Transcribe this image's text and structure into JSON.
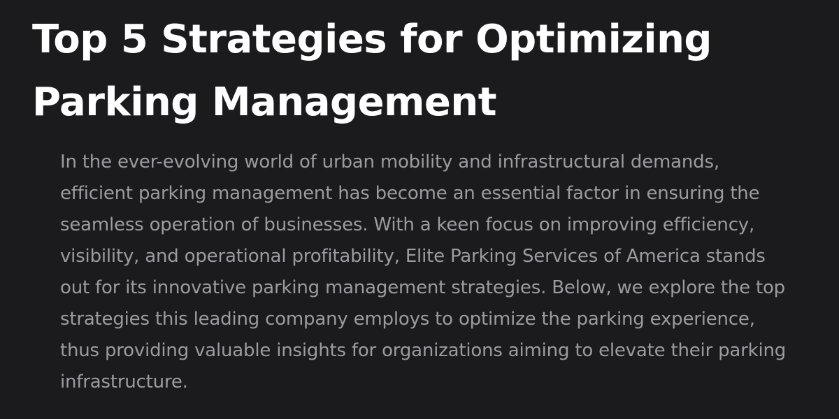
{
  "article": {
    "title": "Top 5 Strategies for Optimizing Parking Management",
    "intro": "In the ever-evolving world of urban mobility and infrastructural demands, efficient parking management has become an essential factor in ensuring the seamless operation of businesses. With a keen focus on improving efficiency, visibility, and operational profitability, Elite Parking Services of America stands out for its innovative parking management strategies. Below, we explore the top strategies this leading company employs to optimize the parking experience, thus providing valuable insights for organizations aiming to elevate their parking infrastructure."
  },
  "colors": {
    "background": "#1b1b1d",
    "title": "#ffffff",
    "body_text": "#9b9ba1"
  }
}
